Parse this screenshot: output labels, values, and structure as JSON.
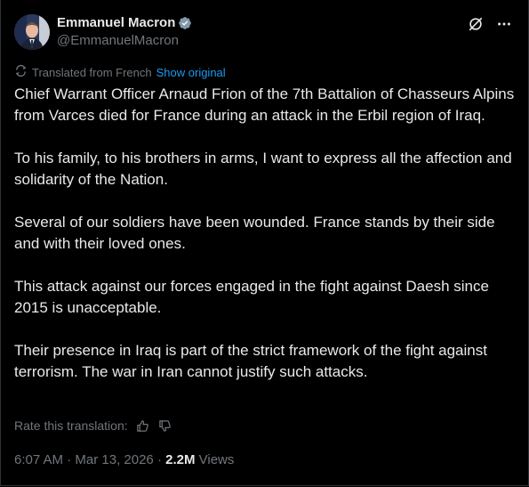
{
  "author": {
    "display_name": "Emmanuel Macron",
    "handle": "@EmmanuelMacron",
    "verified_icon": "verified-badge-icon",
    "verified_color": "#1d9bf0"
  },
  "header_icons": [
    "grok-icon",
    "more-icon"
  ],
  "translation": {
    "label": "Translated from French",
    "show_original": "Show original",
    "icon": "translate-icon"
  },
  "tweet": {
    "paragraphs": [
      "Chief Warrant Officer Arnaud Frion of the 7th Battalion of Chasseurs Alpins from Varces died for France during an attack in the Erbil region of Iraq.",
      "To his family, to his brothers in arms, I want to express all the affection and solidarity of the Nation.",
      "Several of our soldiers have been wounded. France stands by their side and with their loved ones.",
      "This attack against our forces engaged in the fight against Daesh since 2015 is unacceptable.",
      "Their presence in Iraq is part of the strict framework of the fight against terrorism. The war in Iran cannot justify such attacks."
    ]
  },
  "rate": {
    "label": "Rate this translation:",
    "icons": [
      "thumbs-up-icon",
      "thumbs-down-icon"
    ]
  },
  "meta": {
    "time": "6:07 AM",
    "sep1": " · ",
    "date": "Mar 13, 2026",
    "sep2": " · ",
    "views_count": "2.2M",
    "views_label": " Views"
  },
  "colors": {
    "background": "#000000",
    "text": "#e7e9ea",
    "secondary": "#71767b",
    "accent": "#1d9bf0"
  }
}
